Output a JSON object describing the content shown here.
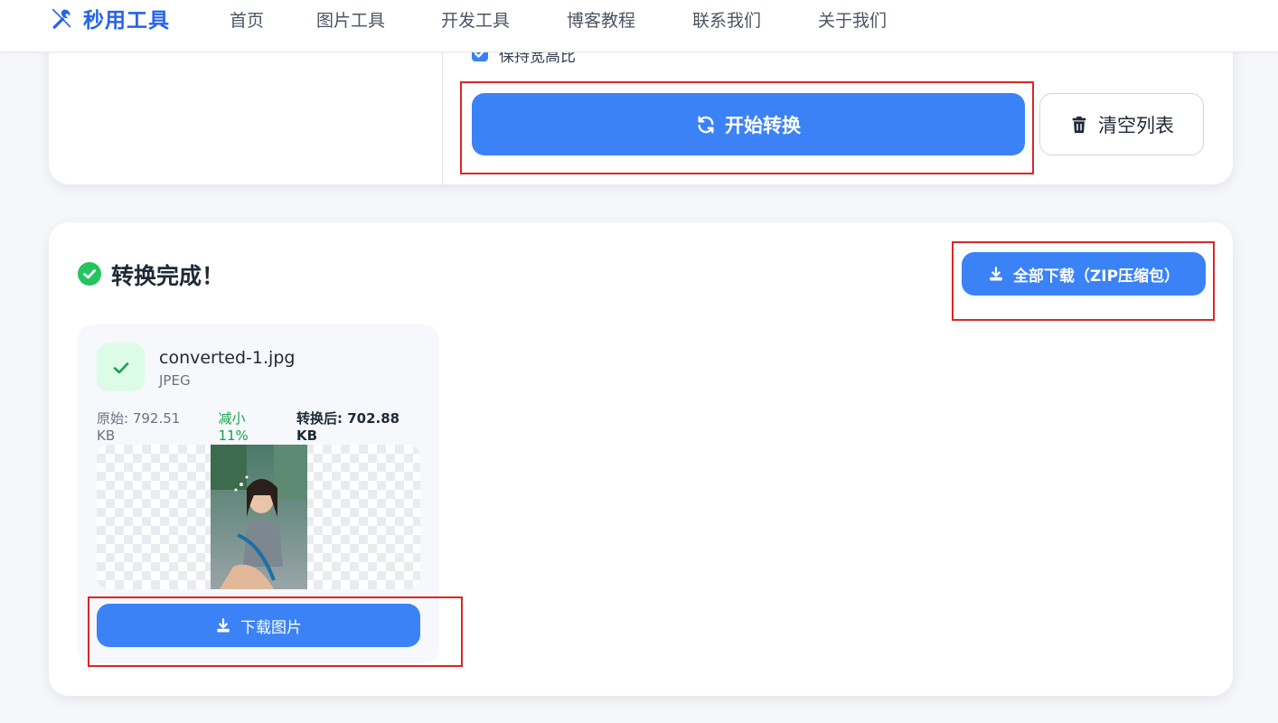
{
  "header": {
    "brand": "秒用工具",
    "nav": [
      "首页",
      "图片工具",
      "开发工具",
      "博客教程",
      "联系我们",
      "关于我们"
    ]
  },
  "settings": {
    "keep_ratio_label": "保持宽高比",
    "convert_button": "开始转换",
    "clear_button": "清空列表"
  },
  "result": {
    "title": "转换完成！",
    "download_all_button": "全部下载（ZIP压缩包）",
    "files": [
      {
        "name": "converted-1.jpg",
        "format": "JPEG",
        "original_size": "原始: 792.51 KB",
        "reduction": "减小 11%",
        "converted_size": "转换后: 702.88 KB",
        "download_button": "下载图片"
      }
    ]
  },
  "colors": {
    "primary": "#3b82f6",
    "success": "#16a34a",
    "annotation": "#dc2626"
  },
  "icons": {
    "brand": "tools-icon",
    "convert": "sync-icon",
    "clear": "trash-icon",
    "done": "check-circle-icon",
    "download": "download-icon"
  }
}
